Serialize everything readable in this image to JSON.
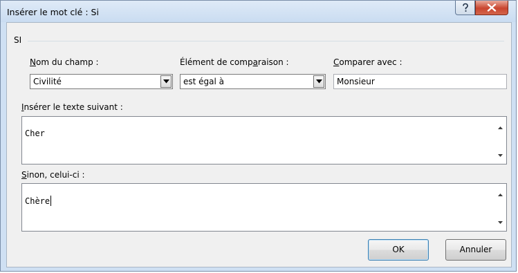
{
  "window": {
    "title": "Insérer le mot clé : Si"
  },
  "group": {
    "label": "SI"
  },
  "field_name": {
    "label_mnemonic": "N",
    "label_rest": "om du champ :",
    "value": "Civilité"
  },
  "comparison": {
    "label_before": "Élément de comp",
    "label_mnemonic": "a",
    "label_after": "raison :",
    "value": "est égal à"
  },
  "compare_with": {
    "label_mnemonic": "C",
    "label_rest": "omparer avec :",
    "value": "Monsieur"
  },
  "insert_text": {
    "label_mnemonic": "I",
    "label_rest": "nsérer le texte suivant :",
    "value": "Cher"
  },
  "otherwise_text": {
    "label_mnemonic": "S",
    "label_rest": "inon, celui-ci :",
    "value": "Chère"
  },
  "buttons": {
    "ok": "OK",
    "cancel": "Annuler"
  },
  "icons": {
    "help": "help-icon",
    "close": "close-icon",
    "dropdown": "chevron-down-icon",
    "scroll_up": "scroll-up-icon",
    "scroll_down": "scroll-down-icon"
  }
}
